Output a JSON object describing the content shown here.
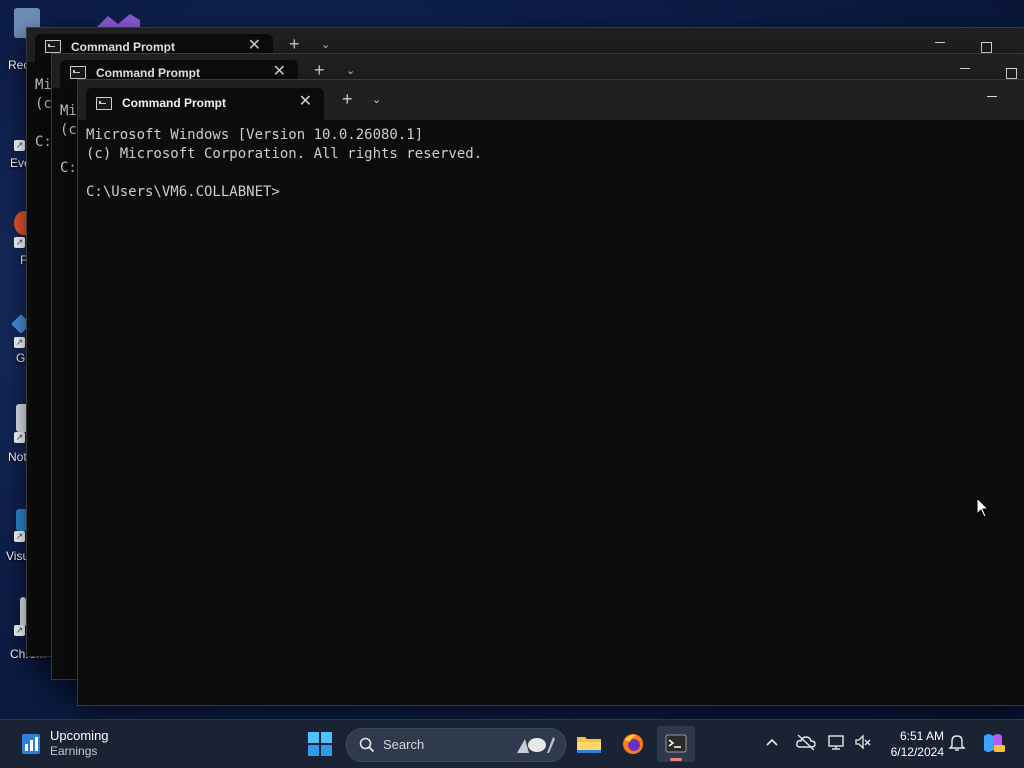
{
  "desktop": {
    "icons": [
      {
        "label": "Rec"
      },
      {
        "label": "Eve"
      },
      {
        "label": "F"
      },
      {
        "label": "G"
      },
      {
        "label": "Not"
      },
      {
        "label": "Visu"
      },
      {
        "label": "Chrom"
      }
    ]
  },
  "windows": [
    {
      "tab_title": "Command Prompt",
      "output": "Mi\n(c\n\nC:"
    },
    {
      "tab_title": "Command Prompt",
      "output": "Mi\n(c\n\nC:"
    },
    {
      "tab_title": "Command Prompt",
      "output": "Microsoft Windows [Version 10.0.26080.1]\n(c) Microsoft Corporation. All rights reserved.\n\nC:\\Users\\VM6.COLLABNET>"
    }
  ],
  "taskbar": {
    "widget": {
      "title": "Upcoming",
      "subtitle": "Earnings"
    },
    "search": {
      "label": "Search"
    },
    "clock": {
      "time": "6:51 AM",
      "date": "6/12/2024"
    },
    "pinned_apps": [
      "file-explorer-icon",
      "firefox-icon",
      "terminal-icon"
    ],
    "active_app": "terminal-icon"
  },
  "colors": {
    "terminal_bg": "#0c0c0c",
    "titlebar_bg": "#202020",
    "terminal_text": "#cccccc",
    "taskbar_bg": "#1a2333",
    "active_indicator": "#f07b7b"
  }
}
